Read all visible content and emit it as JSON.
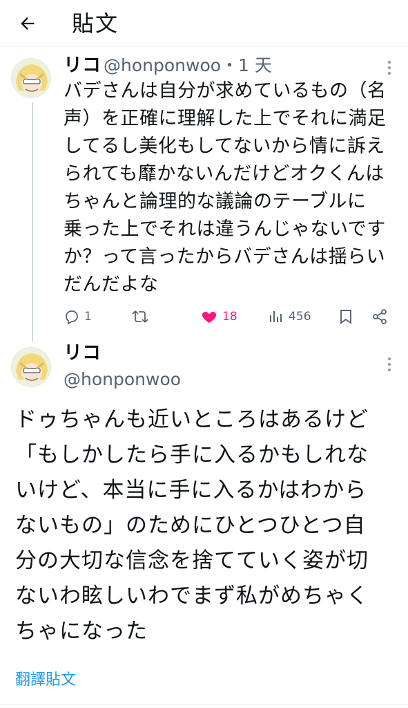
{
  "header": {
    "title": "貼文",
    "back_icon": "arrow-left-icon"
  },
  "reply_tweet": {
    "display_name": "リコ",
    "handle_line": "@honponwoo・1 天",
    "text": "バデさんは自分が求めているもの（名\n声）を正確に理解した上でそれに満足\nしてるし美化もしてないから情に訴え\nられても靡かないんだけどオクくんは\nちゃんと論理的な議論のテーブルに\n乗った上でそれは違うんじゃないです\nか？って言ったからバデさんは揺らい\nだんだよな",
    "actions": {
      "reply_count": "1",
      "retweet_count": "",
      "like_count": "18",
      "view_count": "456"
    },
    "like_color": "#f91880"
  },
  "main_tweet": {
    "display_name": "リコ",
    "handle": "@honponwoo",
    "text": "ドゥちゃんも近いところはあるけど\n「もしかしたら手に入るかもしれな\nいけど、本当に手に入るかはわから\nないもの」のためにひとつひとつ自\n分の大切な信念を捨てていく姿が切\nないわ眩しいわでまず私がめちゃく\nちゃになった",
    "translate_label": "翻譯貼文",
    "link_color": "#1d9bf0"
  }
}
